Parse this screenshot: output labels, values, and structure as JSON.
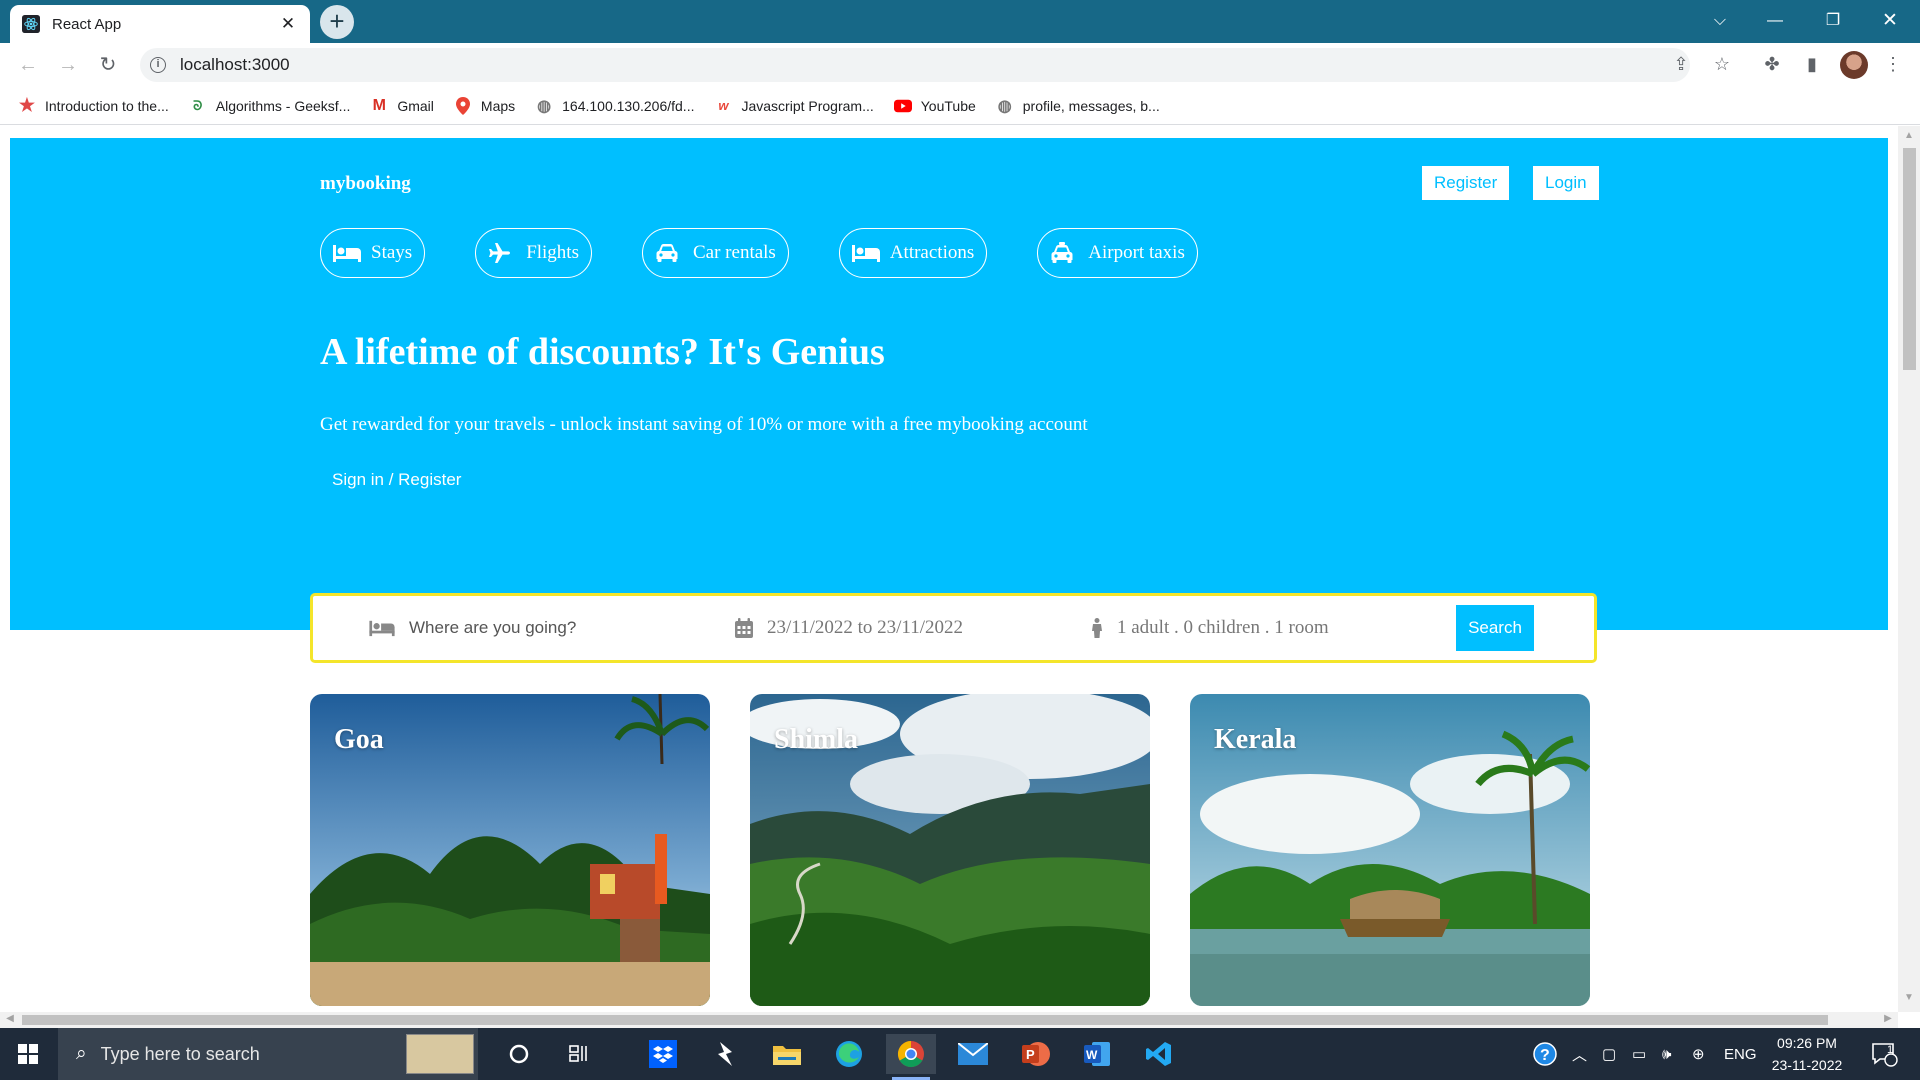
{
  "browser": {
    "tab_title": "React App",
    "tab_close": "✕",
    "new_tab": "+",
    "url": "localhost:3000",
    "bookmarks": [
      {
        "label": "Introduction to the...",
        "icon": "red-star-icon"
      },
      {
        "label": "Algorithms - Geeksf...",
        "icon": "geeksforgeeks-icon"
      },
      {
        "label": "Gmail",
        "icon": "gmail-icon"
      },
      {
        "label": "Maps",
        "icon": "maps-icon"
      },
      {
        "label": "164.100.130.206/fd...",
        "icon": "globe-icon"
      },
      {
        "label": "Javascript Program...",
        "icon": "w3resource-icon"
      },
      {
        "label": "YouTube",
        "icon": "youtube-icon"
      },
      {
        "label": "profile, messages, b...",
        "icon": "globe-icon"
      }
    ]
  },
  "site": {
    "brand": "mybooking",
    "register": "Register",
    "login": "Login",
    "categories": [
      {
        "label": "Stays",
        "icon": "bed-icon"
      },
      {
        "label": "Flights",
        "icon": "plane-icon"
      },
      {
        "label": "Car rentals",
        "icon": "car-icon"
      },
      {
        "label": "Attractions",
        "icon": "bed-icon"
      },
      {
        "label": "Airport taxis",
        "icon": "taxi-icon"
      }
    ],
    "hero_title": "A lifetime of discounts? It's Genius",
    "hero_subtitle": "Get rewarded for your travels - unlock instant saving of 10% or more with a free mybooking account",
    "hero_button": "Sign in / Register",
    "search": {
      "destination_placeholder": "Where are you going?",
      "dates": "23/11/2022 to 23/11/2022",
      "guests": "1 adult . 0 children . 1 room",
      "button": "Search"
    },
    "featured": [
      {
        "title": "Goa"
      },
      {
        "title": "Shimla"
      },
      {
        "title": "Kerala"
      }
    ],
    "colors": {
      "primary": "#00bfff",
      "search_border": "#f4e52a"
    }
  },
  "taskbar": {
    "search_placeholder": "Type here to search",
    "language": "ENG",
    "time": "09:26 PM",
    "date": "23-11-2022",
    "notification_count": "1"
  }
}
